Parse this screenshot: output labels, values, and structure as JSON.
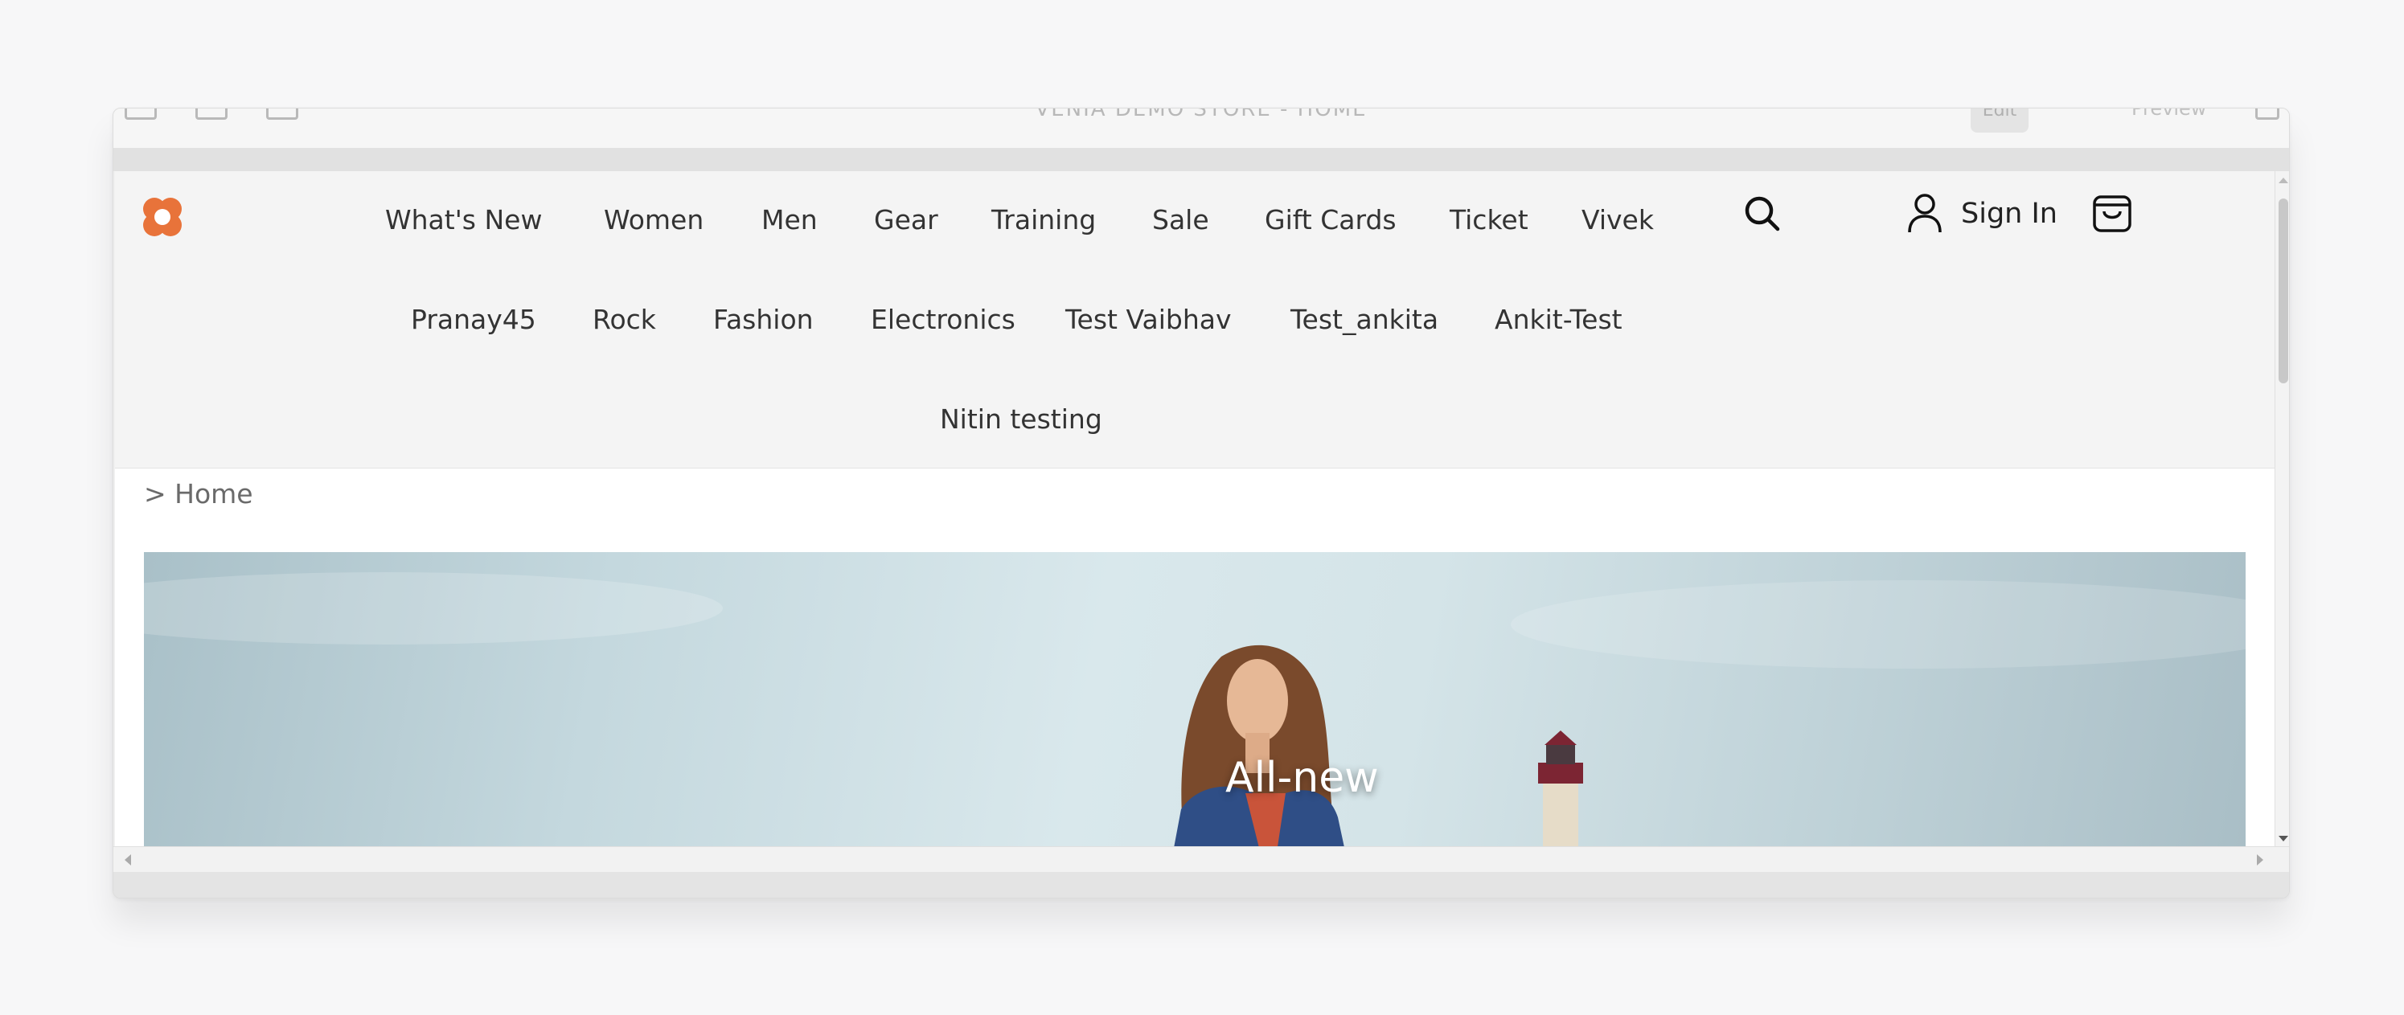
{
  "toolbar": {
    "title": "VENIA DEMO STORE - HOME",
    "edit_label": "Edit",
    "preview_label": "Preview"
  },
  "nav": {
    "row1": [
      "What's New",
      "Women",
      "Men",
      "Gear",
      "Training",
      "Sale",
      "Gift Cards",
      "Ticket",
      "Vivek"
    ],
    "row2": [
      "Pranay45",
      "Rock",
      "Fashion",
      "Electronics",
      "Test Vaibhav",
      "Test_ankita",
      "Ankit-Test"
    ],
    "row3": [
      "Nitin testing"
    ]
  },
  "header": {
    "sign_in_label": "Sign In",
    "brand_color": "#e8733a"
  },
  "breadcrumb": {
    "text": "> Home"
  },
  "hero": {
    "title": "All-new"
  }
}
